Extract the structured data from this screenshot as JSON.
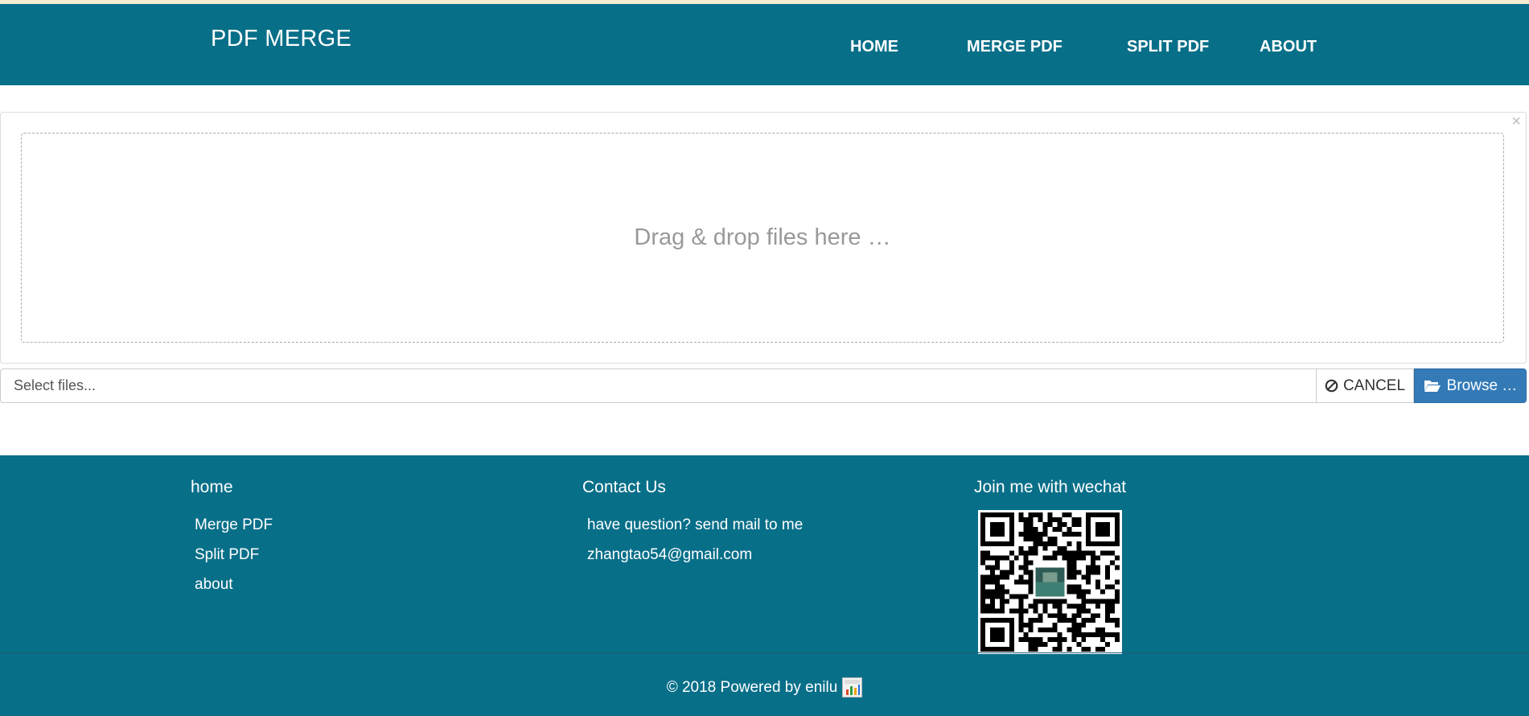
{
  "header": {
    "brand": "PDF MERGE",
    "nav": {
      "home": "HOME",
      "merge": "MERGE PDF",
      "split": "SPLIT PDF",
      "about": "ABOUT"
    }
  },
  "upload": {
    "close_symbol": "×",
    "drop_text": "Drag & drop files here …",
    "file_caption_placeholder": "Select files...",
    "cancel_label": "CANCEL",
    "browse_label": "Browse …",
    "cancel_icon": "ban-icon",
    "browse_icon": "folder-open-icon"
  },
  "footer": {
    "col1": {
      "title": "home",
      "links": [
        "Merge PDF",
        "Split PDF",
        "about"
      ]
    },
    "col2": {
      "title": "Contact Us",
      "lines": [
        "have question? send mail to me",
        "zhangtao54@gmail.com"
      ]
    },
    "col3": {
      "title": "Join me with wechat",
      "qr_icon": "wechat-qr-code"
    },
    "copyright": "© 2018 Powered by enilu",
    "stats_icon": "site-stats-icon"
  },
  "colors": {
    "header_bg": "#086f89",
    "footer_bg": "#086f89",
    "browse_bg": "#337ab7",
    "top_stripe": "#f3ecd0"
  }
}
